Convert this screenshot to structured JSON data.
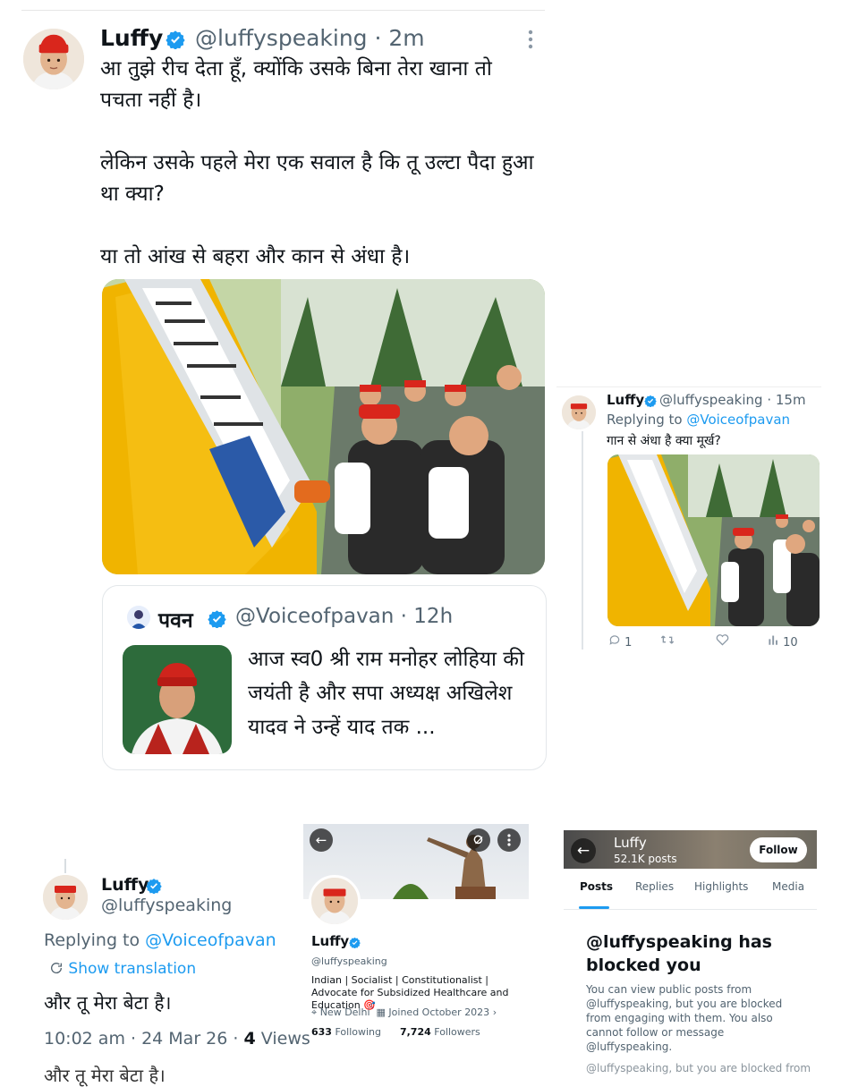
{
  "main_tweet": {
    "name": "Luffy",
    "handle": "@luffyspeaking",
    "time": "2m",
    "text": "आ तुझे रीच देता हूँ, क्योंकि उसके बिना तेरा खाना तो पचता नहीं है।\n\nलेकिन उसके पहले मेरा एक सवाल है कि तू उल्टा पैदा हुआ था क्या?\n\nया तो आंख से बहरा और कान से अंधा है।",
    "quote": {
      "name": "पवन",
      "handle": "@Voiceofpavan",
      "time": "12h",
      "text": "आज स्व0 श्री राम मनोहर लोहिया की जयंती है और सपा अध्यक्ष अखिलेश यादव ने उन्हें याद तक ..."
    }
  },
  "reply_card": {
    "name": "Luffy",
    "handle": "@luffyspeaking",
    "time": "15m",
    "replying_to_label": "Replying to",
    "replying_to_handle": "@Voiceofpavan",
    "text": "गान से अंधा है क्या मूर्ख?",
    "replies": "1",
    "views": "10"
  },
  "reply_detail": {
    "name": "Luffy",
    "handle": "@luffyspeaking",
    "replying_to_label": "Replying to",
    "replying_to_handle": "@Voiceofpavan",
    "show_translation": "Show translation",
    "text": "और तू मेरा बेटा है।",
    "datetime": "10:02 am · 24 Mar 26 ·",
    "views_count": "4",
    "views_label": "Views",
    "cut_text": "और तू मेरा बेटा है।"
  },
  "profile": {
    "name": "Luffy",
    "handle": "@luffyspeaking",
    "bio": "Indian | Socialist | Constitutionalist | Advocate for Subsidized Healthcare and Education 🎯",
    "location": "New Delhi",
    "joined": "Joined October 2023",
    "following_count": "633",
    "following_label": "Following",
    "followers_count": "7,724",
    "followers_label": "Followers"
  },
  "blocked_profile": {
    "title": "Luffy",
    "posts": "52.1K posts",
    "follow_label": "Follow",
    "tabs": [
      "Posts",
      "Replies",
      "Highlights",
      "Media"
    ],
    "heading": "@luffyspeaking has blocked you",
    "text": "You can view public posts from @luffyspeaking, but you are blocked from engaging with them. You also cannot follow or message @luffyspeaking.",
    "cut_text": "@luffyspeaking, but you are blocked from"
  },
  "colors": {
    "accent": "#1d9bf0",
    "muted": "#536471",
    "cap_red": "#d9261c"
  }
}
